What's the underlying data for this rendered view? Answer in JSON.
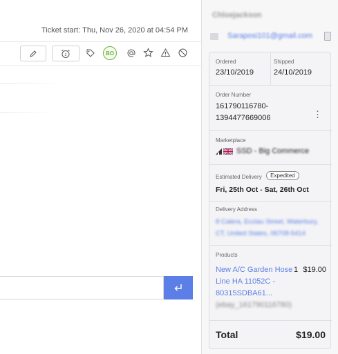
{
  "ticket": {
    "start_text": "Ticket start: Thu, Nov 26, 2020 at 04:54 PM",
    "badge_initials": "BO"
  },
  "icons": {
    "edit": "pencil-icon",
    "snooze": "alarm-clock-icon",
    "tag": "tag-icon",
    "mention": "at-icon",
    "star": "star-icon",
    "warning": "warning-icon",
    "block": "block-icon",
    "send": "enter-arrow-icon"
  },
  "customer": {
    "name": "Chloejackson",
    "email": "Saraposi101@gmail.com"
  },
  "order": {
    "ordered_label": "Ordered",
    "ordered_value": "23/10/2019",
    "shipped_label": "Shipped",
    "shipped_value": "24/10/2019",
    "number_label": "Order Number",
    "number_line1": "161790116780-",
    "number_line2": "1394477669006",
    "marketplace_label": "Marketplace",
    "marketplace_value": "SSD - Big Commerce",
    "delivery_label": "Estimated Delivery",
    "delivery_badge": "Expedited",
    "delivery_value": "Fri, 25th Oct - Sat, 26th Oct",
    "address_label": "Delivery Address",
    "address_line1": "8 Calera, Ecclau Street, Waterbury,",
    "address_line2": "CT, United States, 06708-5414",
    "products_label": "Products",
    "product_name_line1": "New A/C Garden Hose",
    "product_name_line2": "Line HA 11052C -",
    "product_name_line3": "80315SDBA61...",
    "product_sku": "(ebay_161790116780)",
    "product_qty": "1",
    "product_price": "$19.00",
    "total_label": "Total",
    "total_value": "$19.00"
  },
  "colors": {
    "accent": "#5b7fe6",
    "badge_green": "#6db33f"
  }
}
